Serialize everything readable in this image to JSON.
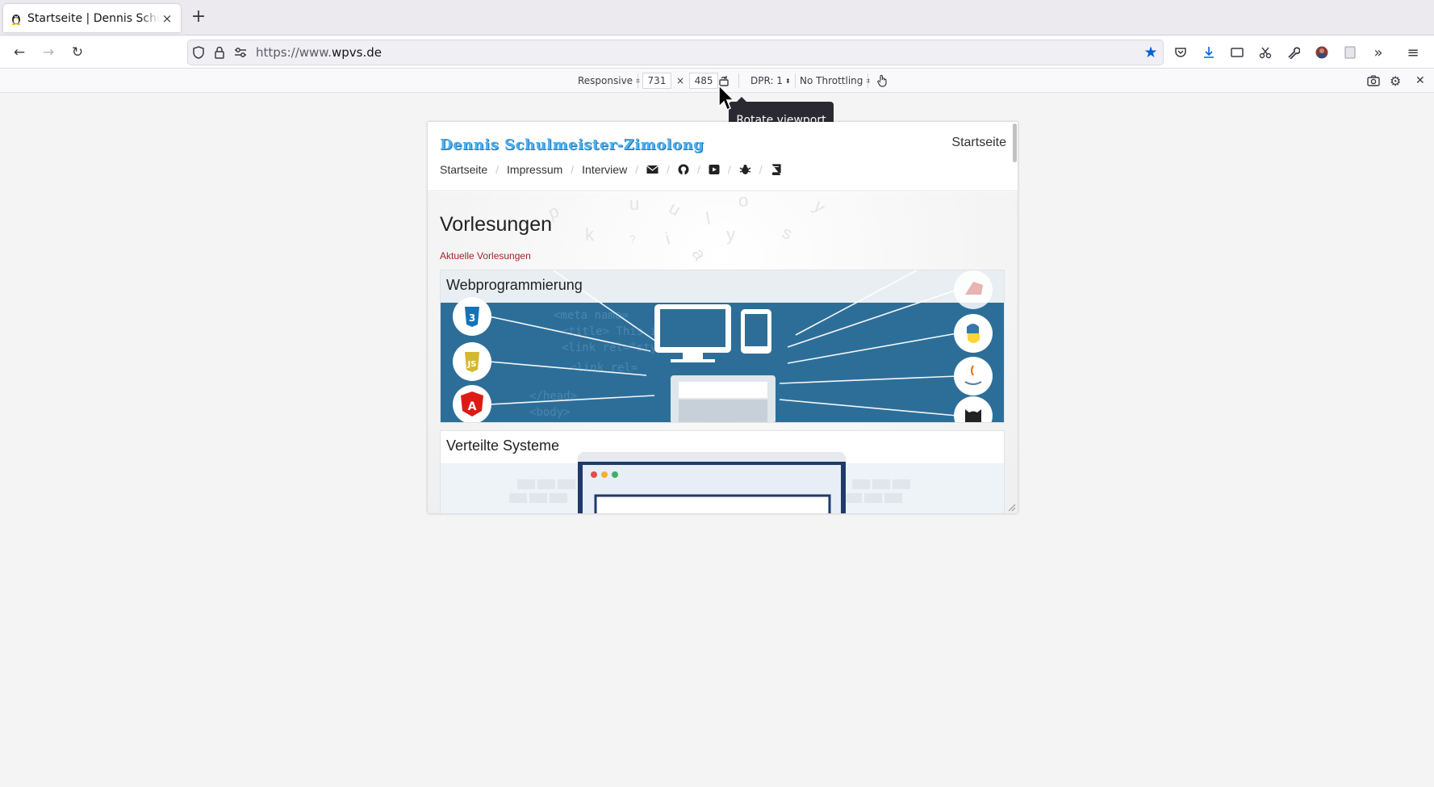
{
  "tab": {
    "title": "Startseite | Dennis Schulmeister",
    "close": "×",
    "new_tab": "+"
  },
  "navbar": {
    "url_prefix": "https://www.",
    "url_domain": "wpvs.de",
    "back": "←",
    "forward": "→",
    "reload": "↻"
  },
  "rdm": {
    "device": "Responsive",
    "width": "731",
    "times": "×",
    "height": "485",
    "dpr": "DPR: 1",
    "throttling": "No Throttling",
    "close": "✕"
  },
  "tooltip": "Rotate viewport",
  "site": {
    "brand": "Dennis Schulmeister-Zimolong",
    "header_right": "Startseite",
    "menu": [
      {
        "label": "Startseite"
      },
      {
        "label": "Impressum"
      },
      {
        "label": "Interview"
      }
    ],
    "menu_icons": [
      "envelope-icon",
      "github-icon",
      "youtube-icon",
      "bug-icon",
      "book-icon"
    ],
    "page_title": "Vorlesungen",
    "subtitle": "Aktuelle Vorlesungen",
    "cards": [
      {
        "title": "Webprogrammierung"
      },
      {
        "title": "Verteilte Systeme"
      }
    ]
  },
  "colors": {
    "accent": "#0061e0",
    "brand": "#4fb0ee",
    "subtitle": "#a3232c",
    "banner_blue": "#2d6e99"
  }
}
